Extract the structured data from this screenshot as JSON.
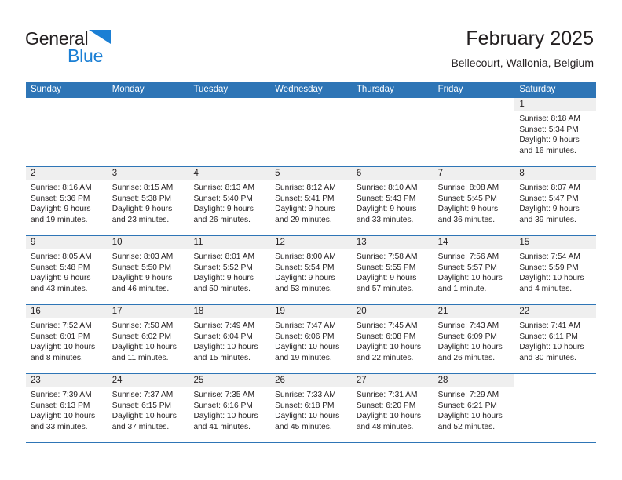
{
  "brand": {
    "word1": "General",
    "word2": "Blue",
    "triangle_color": "#1b7fd4",
    "text_color": "#231f20"
  },
  "header": {
    "title": "February 2025",
    "subtitle": "Bellecourt, Wallonia, Belgium"
  },
  "theme": {
    "header_blue": "#2e75b6",
    "band_gray": "#efefef",
    "text": "#231f20"
  },
  "weekdays": [
    "Sunday",
    "Monday",
    "Tuesday",
    "Wednesday",
    "Thursday",
    "Friday",
    "Saturday"
  ],
  "weeks": [
    [
      {
        "day": "",
        "sunrise": "",
        "sunset": "",
        "daylight": "",
        "empty": true
      },
      {
        "day": "",
        "sunrise": "",
        "sunset": "",
        "daylight": "",
        "empty": true
      },
      {
        "day": "",
        "sunrise": "",
        "sunset": "",
        "daylight": "",
        "empty": true
      },
      {
        "day": "",
        "sunrise": "",
        "sunset": "",
        "daylight": "",
        "empty": true
      },
      {
        "day": "",
        "sunrise": "",
        "sunset": "",
        "daylight": "",
        "empty": true
      },
      {
        "day": "",
        "sunrise": "",
        "sunset": "",
        "daylight": "",
        "empty": true
      },
      {
        "day": "1",
        "sunrise": "Sunrise: 8:18 AM",
        "sunset": "Sunset: 5:34 PM",
        "daylight": "Daylight: 9 hours and 16 minutes.",
        "empty": false
      }
    ],
    [
      {
        "day": "2",
        "sunrise": "Sunrise: 8:16 AM",
        "sunset": "Sunset: 5:36 PM",
        "daylight": "Daylight: 9 hours and 19 minutes.",
        "empty": false
      },
      {
        "day": "3",
        "sunrise": "Sunrise: 8:15 AM",
        "sunset": "Sunset: 5:38 PM",
        "daylight": "Daylight: 9 hours and 23 minutes.",
        "empty": false
      },
      {
        "day": "4",
        "sunrise": "Sunrise: 8:13 AM",
        "sunset": "Sunset: 5:40 PM",
        "daylight": "Daylight: 9 hours and 26 minutes.",
        "empty": false
      },
      {
        "day": "5",
        "sunrise": "Sunrise: 8:12 AM",
        "sunset": "Sunset: 5:41 PM",
        "daylight": "Daylight: 9 hours and 29 minutes.",
        "empty": false
      },
      {
        "day": "6",
        "sunrise": "Sunrise: 8:10 AM",
        "sunset": "Sunset: 5:43 PM",
        "daylight": "Daylight: 9 hours and 33 minutes.",
        "empty": false
      },
      {
        "day": "7",
        "sunrise": "Sunrise: 8:08 AM",
        "sunset": "Sunset: 5:45 PM",
        "daylight": "Daylight: 9 hours and 36 minutes.",
        "empty": false
      },
      {
        "day": "8",
        "sunrise": "Sunrise: 8:07 AM",
        "sunset": "Sunset: 5:47 PM",
        "daylight": "Daylight: 9 hours and 39 minutes.",
        "empty": false
      }
    ],
    [
      {
        "day": "9",
        "sunrise": "Sunrise: 8:05 AM",
        "sunset": "Sunset: 5:48 PM",
        "daylight": "Daylight: 9 hours and 43 minutes.",
        "empty": false
      },
      {
        "day": "10",
        "sunrise": "Sunrise: 8:03 AM",
        "sunset": "Sunset: 5:50 PM",
        "daylight": "Daylight: 9 hours and 46 minutes.",
        "empty": false
      },
      {
        "day": "11",
        "sunrise": "Sunrise: 8:01 AM",
        "sunset": "Sunset: 5:52 PM",
        "daylight": "Daylight: 9 hours and 50 minutes.",
        "empty": false
      },
      {
        "day": "12",
        "sunrise": "Sunrise: 8:00 AM",
        "sunset": "Sunset: 5:54 PM",
        "daylight": "Daylight: 9 hours and 53 minutes.",
        "empty": false
      },
      {
        "day": "13",
        "sunrise": "Sunrise: 7:58 AM",
        "sunset": "Sunset: 5:55 PM",
        "daylight": "Daylight: 9 hours and 57 minutes.",
        "empty": false
      },
      {
        "day": "14",
        "sunrise": "Sunrise: 7:56 AM",
        "sunset": "Sunset: 5:57 PM",
        "daylight": "Daylight: 10 hours and 1 minute.",
        "empty": false
      },
      {
        "day": "15",
        "sunrise": "Sunrise: 7:54 AM",
        "sunset": "Sunset: 5:59 PM",
        "daylight": "Daylight: 10 hours and 4 minutes.",
        "empty": false
      }
    ],
    [
      {
        "day": "16",
        "sunrise": "Sunrise: 7:52 AM",
        "sunset": "Sunset: 6:01 PM",
        "daylight": "Daylight: 10 hours and 8 minutes.",
        "empty": false
      },
      {
        "day": "17",
        "sunrise": "Sunrise: 7:50 AM",
        "sunset": "Sunset: 6:02 PM",
        "daylight": "Daylight: 10 hours and 11 minutes.",
        "empty": false
      },
      {
        "day": "18",
        "sunrise": "Sunrise: 7:49 AM",
        "sunset": "Sunset: 6:04 PM",
        "daylight": "Daylight: 10 hours and 15 minutes.",
        "empty": false
      },
      {
        "day": "19",
        "sunrise": "Sunrise: 7:47 AM",
        "sunset": "Sunset: 6:06 PM",
        "daylight": "Daylight: 10 hours and 19 minutes.",
        "empty": false
      },
      {
        "day": "20",
        "sunrise": "Sunrise: 7:45 AM",
        "sunset": "Sunset: 6:08 PM",
        "daylight": "Daylight: 10 hours and 22 minutes.",
        "empty": false
      },
      {
        "day": "21",
        "sunrise": "Sunrise: 7:43 AM",
        "sunset": "Sunset: 6:09 PM",
        "daylight": "Daylight: 10 hours and 26 minutes.",
        "empty": false
      },
      {
        "day": "22",
        "sunrise": "Sunrise: 7:41 AM",
        "sunset": "Sunset: 6:11 PM",
        "daylight": "Daylight: 10 hours and 30 minutes.",
        "empty": false
      }
    ],
    [
      {
        "day": "23",
        "sunrise": "Sunrise: 7:39 AM",
        "sunset": "Sunset: 6:13 PM",
        "daylight": "Daylight: 10 hours and 33 minutes.",
        "empty": false
      },
      {
        "day": "24",
        "sunrise": "Sunrise: 7:37 AM",
        "sunset": "Sunset: 6:15 PM",
        "daylight": "Daylight: 10 hours and 37 minutes.",
        "empty": false
      },
      {
        "day": "25",
        "sunrise": "Sunrise: 7:35 AM",
        "sunset": "Sunset: 6:16 PM",
        "daylight": "Daylight: 10 hours and 41 minutes.",
        "empty": false
      },
      {
        "day": "26",
        "sunrise": "Sunrise: 7:33 AM",
        "sunset": "Sunset: 6:18 PM",
        "daylight": "Daylight: 10 hours and 45 minutes.",
        "empty": false
      },
      {
        "day": "27",
        "sunrise": "Sunrise: 7:31 AM",
        "sunset": "Sunset: 6:20 PM",
        "daylight": "Daylight: 10 hours and 48 minutes.",
        "empty": false
      },
      {
        "day": "28",
        "sunrise": "Sunrise: 7:29 AM",
        "sunset": "Sunset: 6:21 PM",
        "daylight": "Daylight: 10 hours and 52 minutes.",
        "empty": false
      },
      {
        "day": "",
        "sunrise": "",
        "sunset": "",
        "daylight": "",
        "empty": true
      }
    ]
  ]
}
